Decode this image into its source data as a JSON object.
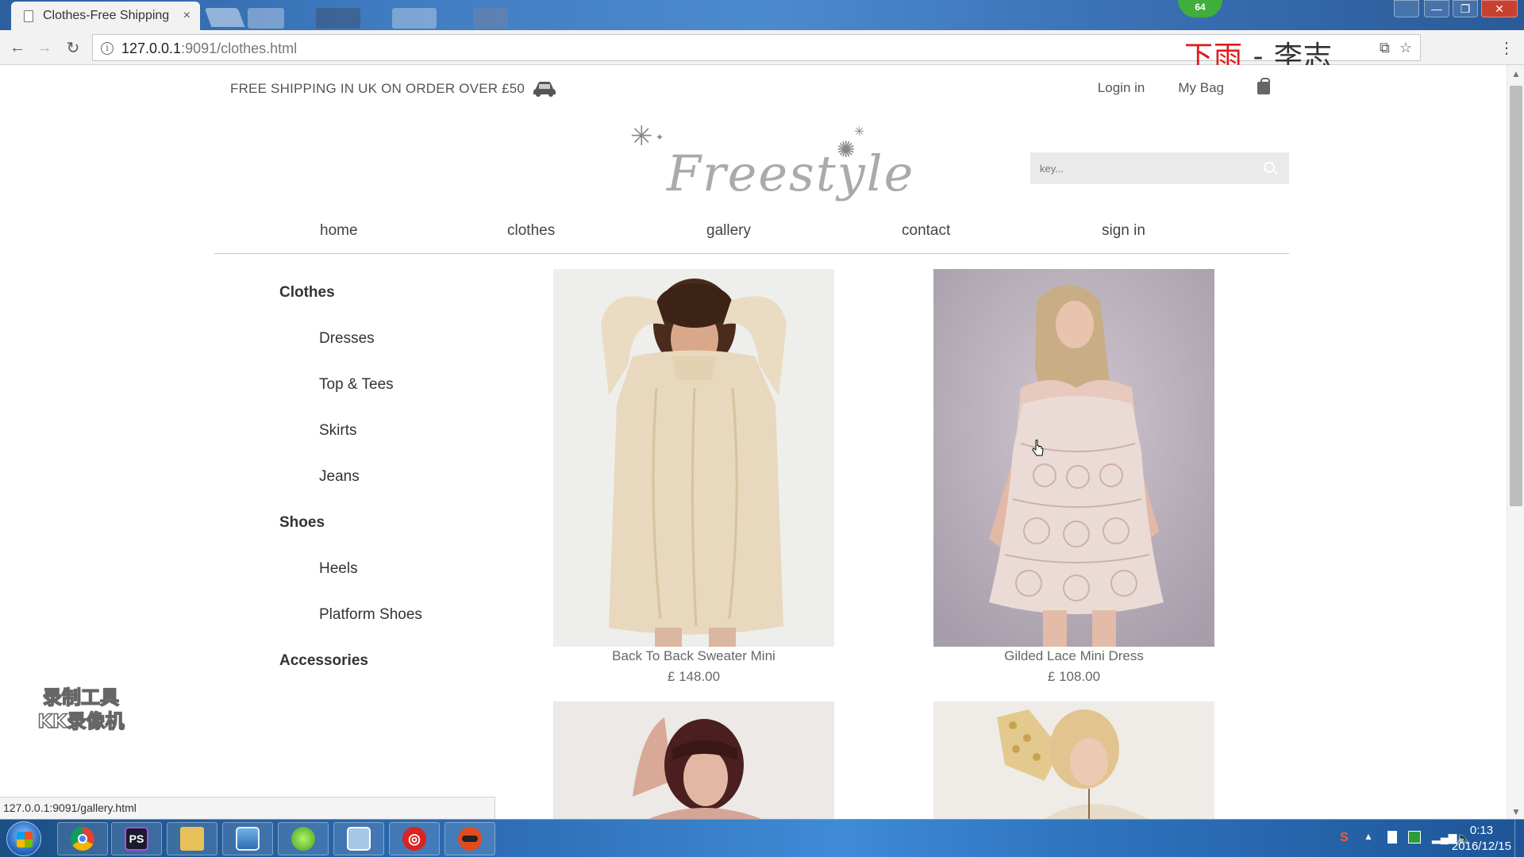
{
  "browser": {
    "tab_title": "Clothes-Free Shipping",
    "tab_close": "×",
    "url_host": "127.0.0.1",
    "url_path": ":9091/clothes.html",
    "status_url": "127.0.0.1:9091/gallery.html",
    "badge_number": "64",
    "overlay_title_red": "下雨",
    "overlay_title_rest": " - 李志"
  },
  "site": {
    "shipping_text": "FREE SHIPPING IN UK ON ORDER OVER £50",
    "login_label": "Login in",
    "bag_label": "My Bag",
    "logo_text": "Freestyle",
    "search_placeholder": "key..."
  },
  "nav": {
    "home": "home",
    "clothes": "clothes",
    "gallery": "gallery",
    "contact": "contact",
    "signin": "sign in"
  },
  "sidebar": {
    "clothes": "Clothes",
    "dresses": "Dresses",
    "tops": "Top & Tees",
    "skirts": "Skirts",
    "jeans": "Jeans",
    "shoes": "Shoes",
    "heels": "Heels",
    "platform": "Platform Shoes",
    "accessories": "Accessories"
  },
  "products": [
    {
      "name": "Back To Back Sweater Mini",
      "price": "£ 148.00"
    },
    {
      "name": "Gilded Lace Mini Dress",
      "price": "£ 108.00"
    }
  ],
  "watermark": {
    "line1": "录制工具",
    "line2": "KK录像机"
  },
  "taskbar": {
    "time": "0:13",
    "date": "2016/12/15",
    "ps_label": "PS"
  },
  "colors": {
    "brand_text": "#aaaaaa",
    "taskbar": "#2b6ab1",
    "red_overlay": "#e11b1b"
  }
}
